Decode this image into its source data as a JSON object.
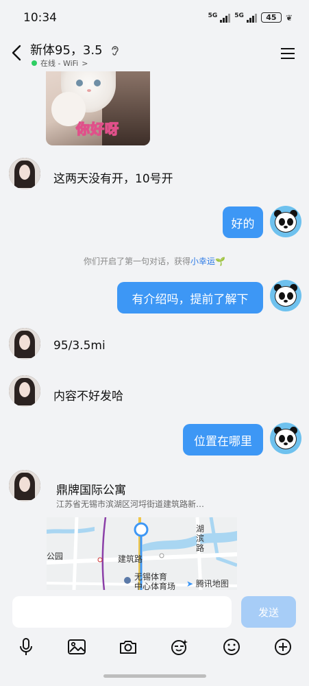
{
  "status_bar": {
    "time": "10:34",
    "network_1": "5G",
    "network_2": "5G",
    "battery": "45"
  },
  "header": {
    "title": "新体95，3.5",
    "status": "在线 - WiFi",
    "status_chevron": ">"
  },
  "messages": [
    {
      "side": "left",
      "type": "sticker",
      "caption": "你好呀"
    },
    {
      "side": "left",
      "type": "text",
      "text": "这两天没有开，10号开"
    },
    {
      "side": "right",
      "type": "text",
      "text": "好的"
    },
    {
      "side": "system",
      "prefix": "你们开启了第一句对话，获得",
      "highlight": "小幸运",
      "icon": "🌱"
    },
    {
      "side": "right",
      "type": "text",
      "text": "有介绍吗，提前了解下"
    },
    {
      "side": "left",
      "type": "text",
      "text": "95/3.5mi"
    },
    {
      "side": "left",
      "type": "text",
      "text": "内容不好发哈"
    },
    {
      "side": "right",
      "type": "text",
      "text": "位置在哪里"
    },
    {
      "side": "left",
      "type": "location",
      "name": "鼎牌国际公寓",
      "address": "江苏省无锡市滨湖区河埒街道建筑路新…",
      "map_labels": [
        "湖滨路",
        "建筑路",
        "无锡体育",
        "中心体育场",
        "公园"
      ],
      "map_brand": "腾讯地图"
    }
  ],
  "composer": {
    "input_value": "",
    "send_label": "发送"
  },
  "colors": {
    "accent": "#3d97f5",
    "send_disabled": "#a7cdf7",
    "online": "#2fce63",
    "highlight": "#2b79e6",
    "background": "#f2f3f5"
  },
  "toolbar_icons": [
    "microphone-icon",
    "image-icon",
    "camera-icon",
    "sticker-icon",
    "emoji-icon",
    "plus-icon"
  ]
}
